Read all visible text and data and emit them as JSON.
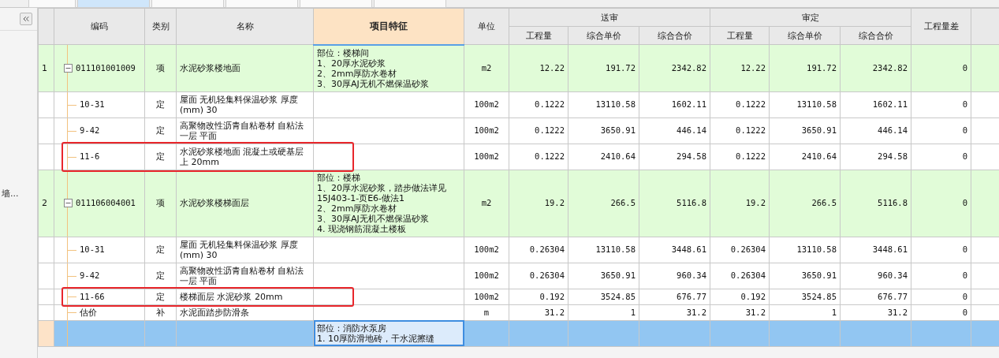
{
  "tabs": [
    {
      "selected": false
    },
    {
      "selected": true
    },
    {
      "selected": false
    },
    {
      "selected": false
    },
    {
      "selected": false
    },
    {
      "selected": false
    }
  ],
  "sidebar": {
    "items": [
      "墙..."
    ]
  },
  "header": {
    "code": "编码",
    "type": "类别",
    "name": "名称",
    "features": "项目特征",
    "features_active": true,
    "unit": "单位",
    "submitted": {
      "label": "送审",
      "columns": [
        "工程量",
        "综合单价",
        "综合合价"
      ]
    },
    "approved": {
      "label": "审定",
      "columns": [
        "工程量",
        "综合单价",
        "综合合价"
      ]
    },
    "diff": "工程量差"
  },
  "rows": [
    {
      "kind": "item",
      "number": "1",
      "code": "011101001009",
      "expanded": true,
      "type": "项",
      "name": "水泥砂浆楼地面",
      "features": [
        "部位：楼梯间",
        "1、20厚水泥砂浆",
        "2、2mm厚防水卷材",
        "3、30厚AJ无机不燃保温砂浆"
      ],
      "unit": "m2",
      "values": [
        "12.22",
        "191.72",
        "2342.82",
        "12.22",
        "191.72",
        "2342.82",
        "0"
      ],
      "highlighted": false,
      "selected": false
    },
    {
      "kind": "norm",
      "code": "10-31",
      "type": "定",
      "name": "屋面 无机轻集料保温砂浆 厚度(mm) 30",
      "features": [],
      "unit": "100m2",
      "values": [
        "0.1222",
        "13110.58",
        "1602.11",
        "0.1222",
        "13110.58",
        "1602.11",
        "0"
      ],
      "highlighted": false,
      "selected": false
    },
    {
      "kind": "norm",
      "code": "9-42",
      "type": "定",
      "name": "高聚物改性沥青自粘卷材 自粘法一层 平面",
      "features": [],
      "unit": "100m2",
      "values": [
        "0.1222",
        "3650.91",
        "446.14",
        "0.1222",
        "3650.91",
        "446.14",
        "0"
      ],
      "highlighted": false,
      "selected": false
    },
    {
      "kind": "norm",
      "code": "11-6",
      "type": "定",
      "name": "水泥砂浆楼地面 混凝土或硬基层上 20mm",
      "features": [],
      "unit": "100m2",
      "values": [
        "0.1222",
        "2410.64",
        "294.58",
        "0.1222",
        "2410.64",
        "294.58",
        "0"
      ],
      "highlighted": true,
      "selected": false
    },
    {
      "kind": "item",
      "number": "2",
      "code": "011106004001",
      "expanded": true,
      "type": "项",
      "name": "水泥砂浆楼梯面层",
      "features": [
        "部位：楼梯",
        "1、20厚水泥砂浆，踏步做法详见15J403-1-页E6-做法1",
        "2、2mm厚防水卷材",
        "3、30厚AJ无机不燃保温砂浆",
        "4. 现浇钢筋混凝土楼板"
      ],
      "unit": "m2",
      "values": [
        "19.2",
        "266.5",
        "5116.8",
        "19.2",
        "266.5",
        "5116.8",
        "0"
      ],
      "highlighted": false,
      "selected": false
    },
    {
      "kind": "norm",
      "code": "10-31",
      "type": "定",
      "name": "屋面 无机轻集料保温砂浆 厚度(mm) 30",
      "features": [],
      "unit": "100m2",
      "values": [
        "0.26304",
        "13110.58",
        "3448.61",
        "0.26304",
        "13110.58",
        "3448.61",
        "0"
      ],
      "highlighted": false,
      "selected": false
    },
    {
      "kind": "norm",
      "code": "9-42",
      "type": "定",
      "name": "高聚物改性沥青自粘卷材 自粘法一层 平面",
      "features": [],
      "unit": "100m2",
      "values": [
        "0.26304",
        "3650.91",
        "960.34",
        "0.26304",
        "3650.91",
        "960.34",
        "0"
      ],
      "highlighted": false,
      "selected": false
    },
    {
      "kind": "norm",
      "code": "11-66",
      "type": "定",
      "name": "楼梯面层 水泥砂浆 20mm",
      "features": [],
      "unit": "100m2",
      "values": [
        "0.192",
        "3524.85",
        "676.77",
        "0.192",
        "3524.85",
        "676.77",
        "0"
      ],
      "highlighted": true,
      "selected": false
    },
    {
      "kind": "norm",
      "code": "估价",
      "type": "补",
      "name": "水泥面踏步防滑条",
      "features": [],
      "unit": "m",
      "values": [
        "31.2",
        "1",
        "31.2",
        "31.2",
        "1",
        "31.2",
        "0"
      ],
      "highlighted": false,
      "selected": false
    },
    {
      "kind": "item",
      "code": "",
      "type": "",
      "name": "",
      "features": [
        "部位：消防水泵房",
        "1. 10厚防滑地砖，干水泥擦缝"
      ],
      "unit": "",
      "values": [],
      "highlighted": false,
      "selected": true
    }
  ]
}
